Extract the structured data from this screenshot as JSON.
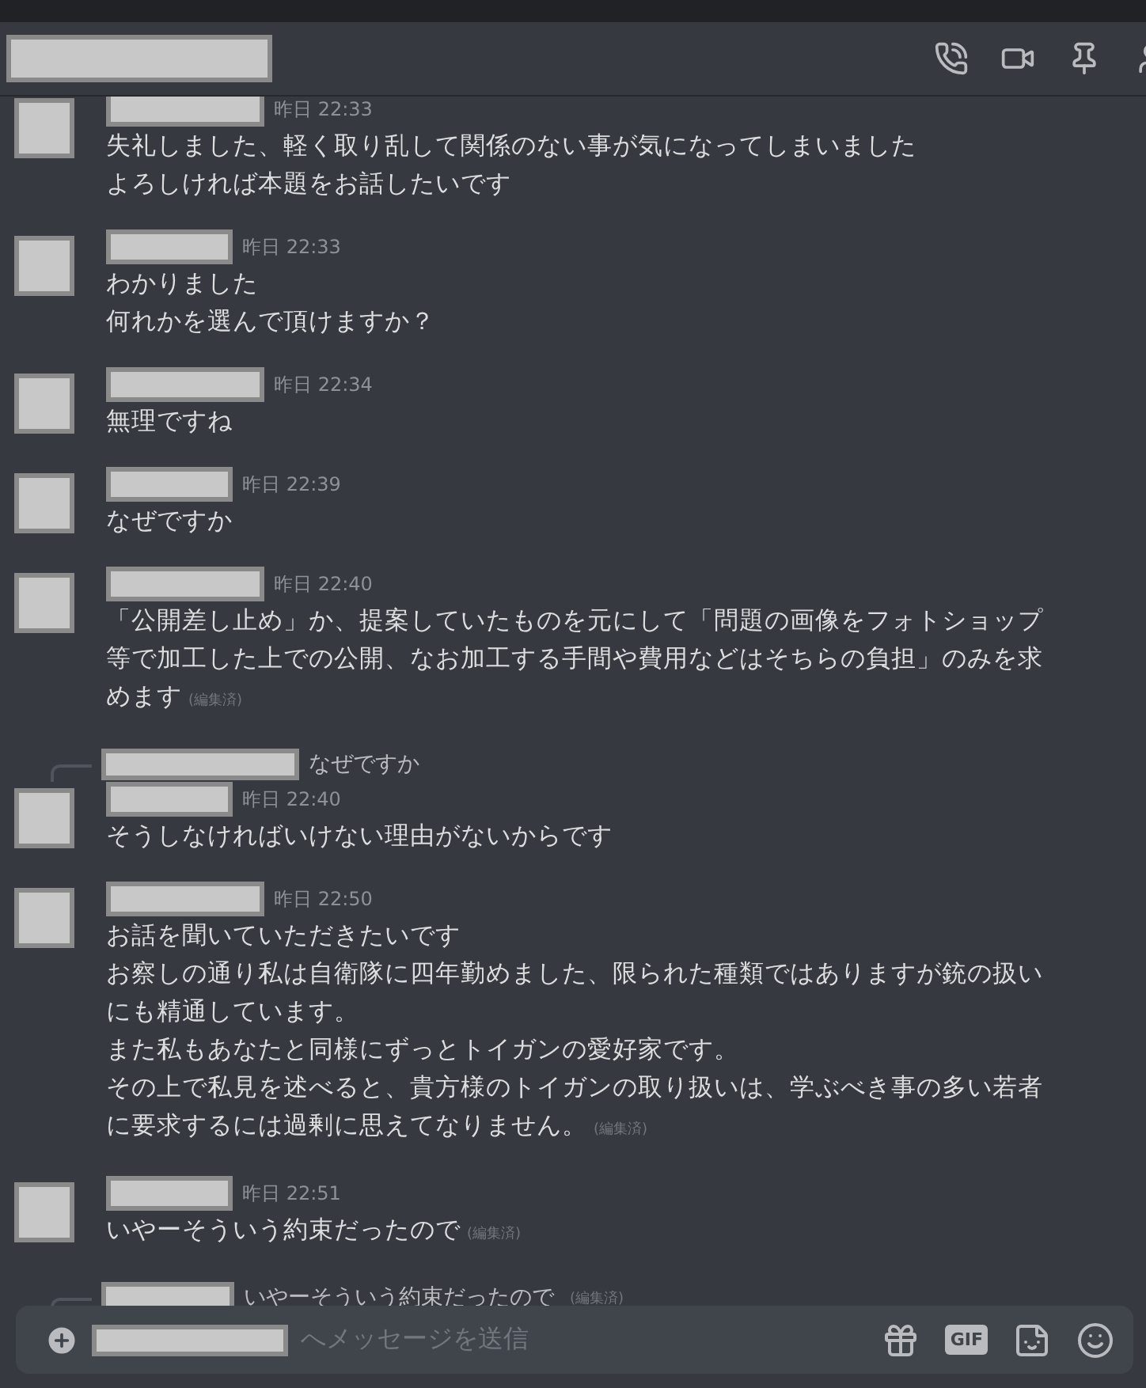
{
  "messages": [
    {
      "timestamp": "昨日 22:33",
      "lines": [
        "失礼しました、軽く取り乱して関係のない事が気になってしまいました",
        "よろしければ本題をお話したいです"
      ]
    },
    {
      "timestamp": "昨日 22:33",
      "lines": [
        "わかりました",
        "何れかを選んで頂けますか？"
      ]
    },
    {
      "timestamp": "昨日 22:34",
      "lines": [
        "無理ですね"
      ]
    },
    {
      "timestamp": "昨日 22:39",
      "lines": [
        "なぜですか"
      ]
    },
    {
      "timestamp": "昨日 22:40",
      "lines": [
        "「公開差し止め」か、提案していたものを元にして「問題の画像をフォトショップ",
        "等で加工した上での公開、なお加工する手間や費用などはそちらの負担」のみを求",
        "めます"
      ],
      "edited_label": "(編集済)"
    },
    {
      "reply": {
        "text": "なぜですか"
      },
      "timestamp": "昨日 22:40",
      "lines": [
        "そうしなければいけない理由がないからです"
      ]
    },
    {
      "timestamp": "昨日 22:50",
      "lines": [
        "お話を聞いていただきたいです",
        "お察しの通り私は自衛隊に四年勤めました、限られた種類ではありますが銃の扱い",
        "にも精通しています。",
        "また私もあなたと同様にずっとトイガンの愛好家です。",
        "その上で私見を述べると、貴方様のトイガンの取り扱いは、学ぶべき事の多い若者",
        "に要求するには過剰に思えてなりません。"
      ],
      "edited_label": "(編集済)"
    },
    {
      "timestamp": "昨日 22:51",
      "lines": [
        "いやーそういう約束だったので"
      ],
      "edited_label": "(編集済)"
    },
    {
      "reply": {
        "text": "いやーそういう約束だったので",
        "edited_label": "(編集済)"
      }
    }
  ],
  "composer": {
    "placeholder": "へメッセージを送信",
    "gif_label": "GIF"
  }
}
